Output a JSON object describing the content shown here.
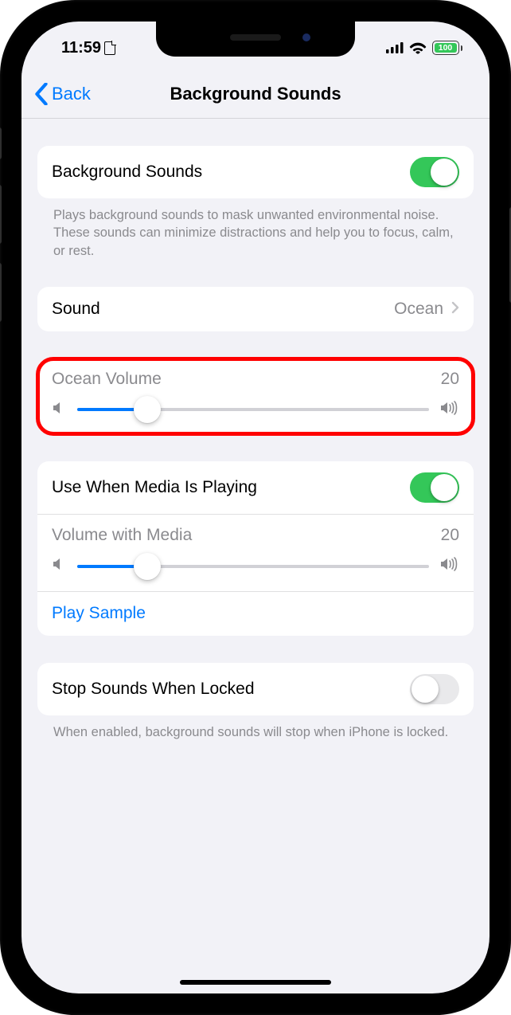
{
  "statusBar": {
    "time": "11:59",
    "batteryLevel": "100"
  },
  "nav": {
    "backLabel": "Back",
    "title": "Background Sounds"
  },
  "section1": {
    "toggleLabel": "Background Sounds",
    "toggleOn": true,
    "footer": "Plays background sounds to mask unwanted environmental noise. These sounds can minimize distractions and help you to focus, calm, or rest."
  },
  "soundRow": {
    "label": "Sound",
    "value": "Ocean"
  },
  "volume": {
    "label": "Ocean Volume",
    "value": "20",
    "percent": 20
  },
  "mediaSection": {
    "toggleLabel": "Use When Media Is Playing",
    "toggleOn": true,
    "volumeLabel": "Volume with Media",
    "volumeValue": "20",
    "volumePercent": 20,
    "playSample": "Play Sample"
  },
  "lockedSection": {
    "toggleLabel": "Stop Sounds When Locked",
    "toggleOn": false,
    "footer": "When enabled, background sounds will stop when iPhone is locked."
  },
  "colors": {
    "tint": "#007aff",
    "green": "#34c759",
    "red": "#ff0000"
  }
}
